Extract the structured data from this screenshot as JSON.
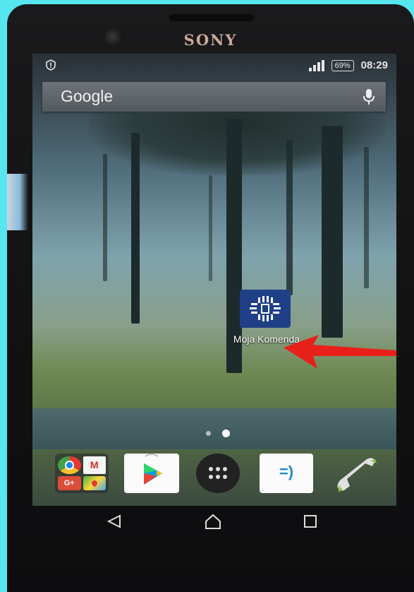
{
  "device": {
    "brand": "SONY"
  },
  "status_bar": {
    "left_icon": "shield-alert-icon",
    "battery": "69%",
    "time": "08:29",
    "signal_icon": "signal-icon"
  },
  "search_bar": {
    "logo_text": "Google",
    "mic_icon": "microphone-icon"
  },
  "home_screen": {
    "app": {
      "label": "Moja Komenda",
      "icon": "moja-komenda-icon"
    },
    "annotation": {
      "icon": "red-arrow-icon",
      "color": "#e8201a"
    },
    "page_indicator": {
      "pages": 2,
      "active": 2
    }
  },
  "dock": {
    "items": [
      {
        "name": "google-apps-folder",
        "apps": [
          "chrome-icon",
          "gmail-icon",
          "google-plus-icon",
          "maps-icon"
        ]
      },
      {
        "name": "play-store-icon"
      },
      {
        "name": "app-drawer-icon"
      },
      {
        "name": "messaging-icon"
      },
      {
        "name": "phone-icon"
      }
    ]
  },
  "nav_bar": {
    "buttons": [
      "back-icon",
      "home-icon",
      "recents-icon"
    ]
  }
}
